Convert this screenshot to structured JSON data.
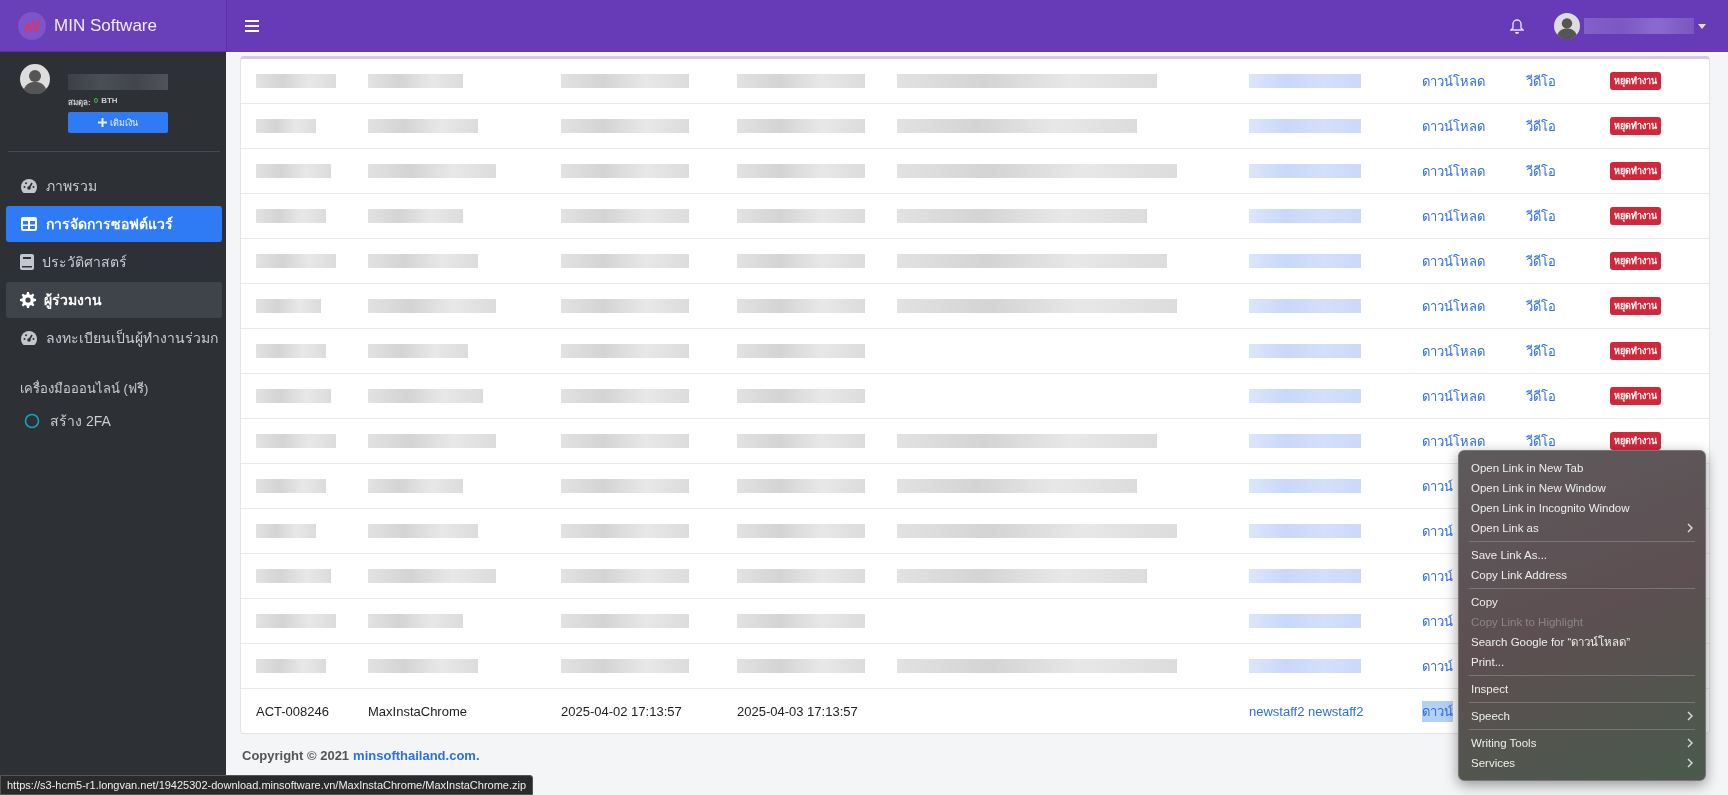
{
  "brand": {
    "name": "MIN Software"
  },
  "sidebar": {
    "user": {
      "balance_label": "สมดุล:",
      "balance_value": "0",
      "currency": "BTH",
      "topup_button": "เติมเงิน"
    },
    "items": [
      {
        "kind": "gauge",
        "label": "ภาพรวม",
        "selected": false,
        "hovered": false
      },
      {
        "kind": "table",
        "label": "การจัดการซอฟต์แวร์",
        "selected": true,
        "hovered": false
      },
      {
        "kind": "book",
        "label": "ประวัติศาสตร์",
        "selected": false,
        "hovered": false
      },
      {
        "kind": "gear",
        "label": "ผู้ร่วมงาน",
        "selected": false,
        "hovered": true
      },
      {
        "kind": "gauge",
        "label": "ลงทะเบียนเป็นผู้ทำงานร่วมก",
        "selected": false,
        "hovered": false
      }
    ],
    "section_title": "เครื่องมือออนไลน์ (ฟรี)",
    "tools": [
      {
        "kind": "circle",
        "label": "สร้าง 2FA"
      }
    ]
  },
  "table": {
    "rows": [
      {
        "kind": "redacted",
        "download": "ดาวน์โหลด",
        "video": "วีดีโอ",
        "status": "หยุดทำงาน",
        "highlighted": false
      },
      {
        "kind": "redacted",
        "download": "ดาวน์โหลด",
        "video": "วีดีโอ",
        "status": "หยุดทำงาน",
        "highlighted": false
      },
      {
        "kind": "redacted",
        "download": "ดาวน์โหลด",
        "video": "วีดีโอ",
        "status": "หยุดทำงาน",
        "highlighted": false
      },
      {
        "kind": "redacted",
        "download": "ดาวน์โหลด",
        "video": "วีดีโอ",
        "status": "หยุดทำงาน",
        "highlighted": false
      },
      {
        "kind": "redacted",
        "download": "ดาวน์โหลด",
        "video": "วีดีโอ",
        "status": "หยุดทำงาน",
        "highlighted": false
      },
      {
        "kind": "redacted",
        "download": "ดาวน์โหลด",
        "video": "วีดีโอ",
        "status": "หยุดทำงาน",
        "highlighted": false
      },
      {
        "kind": "redacted",
        "download": "ดาวน์โหลด",
        "video": "วีดีโอ",
        "status": "หยุดทำงาน",
        "highlighted": false
      },
      {
        "kind": "redacted",
        "download": "ดาวน์โหลด",
        "video": "วีดีโอ",
        "status": "หยุดทำงาน",
        "highlighted": false
      },
      {
        "kind": "redacted",
        "download": "ดาวน์โหลด",
        "video": "วีดีโอ",
        "status": "หยุดทำงาน",
        "highlighted": false
      },
      {
        "kind": "redacted",
        "download": "ดาวน์",
        "highlighted": false
      },
      {
        "kind": "redacted",
        "download": "ดาวน์",
        "highlighted": false
      },
      {
        "kind": "redacted",
        "download": "ดาวน์",
        "highlighted": false
      },
      {
        "kind": "redacted",
        "download": "ดาวน์",
        "highlighted": false
      },
      {
        "kind": "redacted",
        "download": "ดาวน์",
        "highlighted": false
      },
      {
        "kind": "data",
        "id": "ACT-008246",
        "software": "MaxInstaChrome",
        "start": "2025-04-02 17:13:57",
        "end": "2025-04-03 17:13:57",
        "staff": "newstaff2 newstaff2",
        "download": "ดาวน์",
        "highlighted": true
      }
    ]
  },
  "footer": {
    "text": "Copyright © 2021",
    "link": "minsofthailand.com."
  },
  "context_menu": {
    "groups": [
      [
        {
          "label": "Open Link in New Tab",
          "submenu": false,
          "disabled": false
        },
        {
          "label": "Open Link in New Window",
          "submenu": false,
          "disabled": false
        },
        {
          "label": "Open Link in Incognito Window",
          "submenu": false,
          "disabled": false
        },
        {
          "label": "Open Link as",
          "submenu": true,
          "disabled": false
        }
      ],
      [
        {
          "label": "Save Link As...",
          "submenu": false,
          "disabled": false
        },
        {
          "label": "Copy Link Address",
          "submenu": false,
          "disabled": false
        }
      ],
      [
        {
          "label": "Copy",
          "submenu": false,
          "disabled": false
        },
        {
          "label": "Copy Link to Highlight",
          "submenu": false,
          "disabled": true
        },
        {
          "label": "Search Google for “ดาวน์โหลด”",
          "submenu": false,
          "disabled": false
        },
        {
          "label": "Print...",
          "submenu": false,
          "disabled": false
        }
      ],
      [
        {
          "label": "Inspect",
          "submenu": false,
          "disabled": false
        }
      ],
      [
        {
          "label": "Speech",
          "submenu": true,
          "disabled": false
        }
      ],
      [
        {
          "label": "Writing Tools",
          "submenu": true,
          "disabled": false
        },
        {
          "label": "Services",
          "submenu": true,
          "disabled": false
        }
      ]
    ]
  },
  "status_bar": {
    "url": "https://s3-hcm5-r1.longvan.net/19425302-download.minsoftware.vn/MaxInstaChrome/MaxInstaChrome.zip"
  }
}
